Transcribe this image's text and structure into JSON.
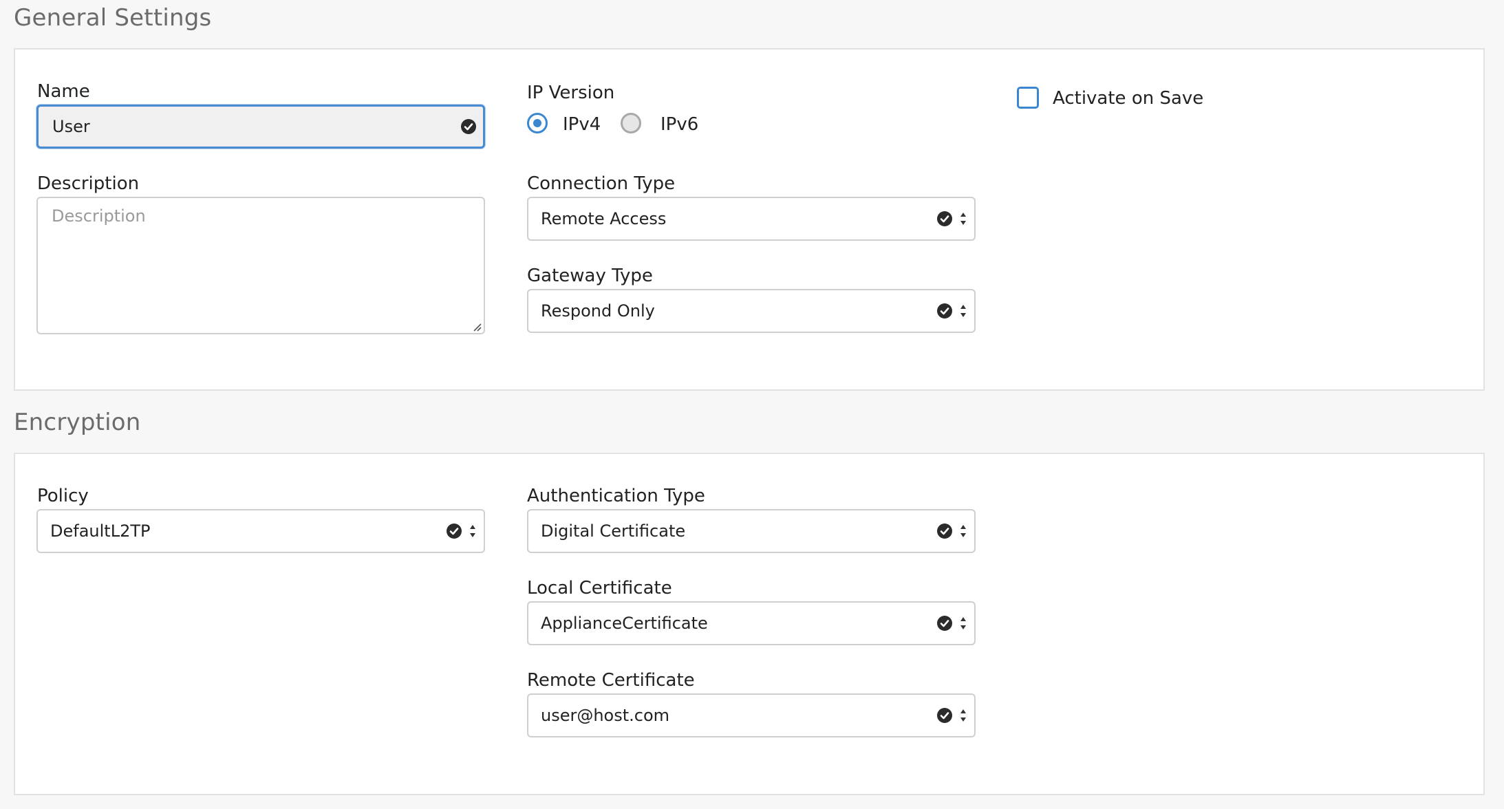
{
  "general": {
    "title": "General Settings",
    "name_label": "Name",
    "name_value": "User",
    "description_label": "Description",
    "description_placeholder": "Description",
    "ip_version_label": "IP Version",
    "ipv4_label": "IPv4",
    "ipv6_label": "IPv6",
    "ip_version_selected": "IPv4",
    "connection_type_label": "Connection Type",
    "connection_type_value": "Remote Access",
    "gateway_type_label": "Gateway Type",
    "gateway_type_value": "Respond Only",
    "activate_label": "Activate on Save",
    "activate_checked": false
  },
  "encryption": {
    "title": "Encryption",
    "policy_label": "Policy",
    "policy_value": "DefaultL2TP",
    "auth_type_label": "Authentication Type",
    "auth_type_value": "Digital Certificate",
    "local_cert_label": "Local Certificate",
    "local_cert_value": "ApplianceCertificate",
    "remote_cert_label": "Remote Certificate",
    "remote_cert_value": "user@host.com"
  },
  "colors": {
    "accent": "#3a86d1",
    "panel_border": "#e2e2e2",
    "section_title": "#6b6b6b"
  },
  "icons": {
    "valid": "check-circle-icon",
    "select": "up-down-arrows-icon",
    "resize": "resize-grip-icon"
  }
}
